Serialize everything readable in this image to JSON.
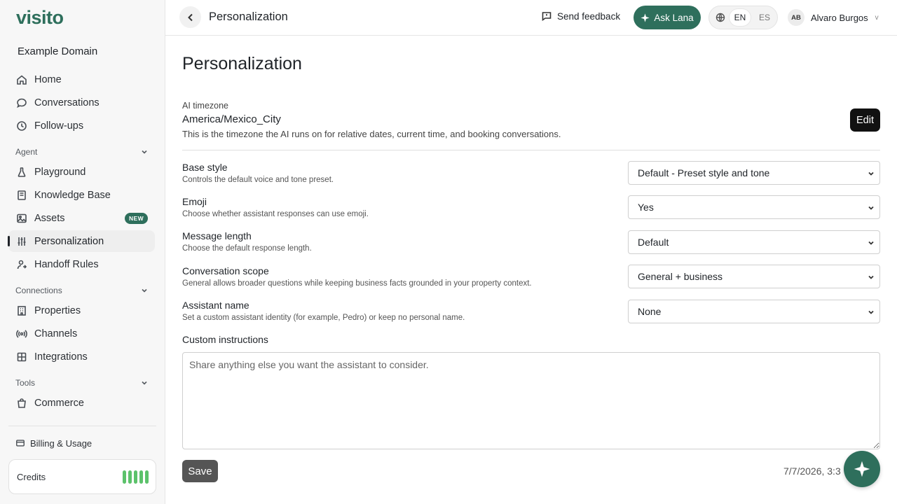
{
  "brand": {
    "logo": "visito",
    "domain": "Example Domain",
    "accent": "#2e6f5c"
  },
  "sidebar": {
    "top_items": [
      {
        "label": "Home",
        "icon": "home-icon"
      },
      {
        "label": "Conversations",
        "icon": "chat-bubble-icon"
      },
      {
        "label": "Follow-ups",
        "icon": "clock-icon"
      }
    ],
    "agent_section": "Agent",
    "agent_items": [
      {
        "label": "Playground",
        "icon": "flask-icon"
      },
      {
        "label": "Knowledge Base",
        "icon": "book-icon"
      },
      {
        "label": "Assets",
        "icon": "image-icon",
        "badge": "NEW"
      },
      {
        "label": "Personalization",
        "icon": "sliders-icon",
        "active": true
      },
      {
        "label": "Handoff Rules",
        "icon": "user-handoff-icon"
      }
    ],
    "connections_section": "Connections",
    "connections_items": [
      {
        "label": "Properties",
        "icon": "building-icon"
      },
      {
        "label": "Channels",
        "icon": "broadcast-icon"
      },
      {
        "label": "Integrations",
        "icon": "puzzle-icon"
      }
    ],
    "tools_section": "Tools",
    "tools_items": [
      {
        "label": "Commerce",
        "icon": "shopping-bag-icon"
      }
    ],
    "billing": "Billing & Usage",
    "credits": "Credits"
  },
  "header": {
    "title": "Personalization",
    "feedback": "Send feedback",
    "ask": "Ask Lana",
    "lang_en": "EN",
    "lang_es": "ES",
    "user_initials": "AB",
    "user_name": "Alvaro Burgos",
    "user_chevron": "v"
  },
  "main": {
    "title": "Personalization",
    "timezone": {
      "label": "AI timezone",
      "value": "America/Mexico_City",
      "desc": "This is the timezone the AI runs on for relative dates, current time, and booking conversations.",
      "edit": "Edit"
    },
    "fields": [
      {
        "label": "Base style",
        "desc": "Controls the default voice and tone preset.",
        "value": "Default - Preset style and tone"
      },
      {
        "label": "Emoji",
        "desc": "Choose whether assistant responses can use emoji.",
        "value": "Yes"
      },
      {
        "label": "Message length",
        "desc": "Choose the default response length.",
        "value": "Default"
      },
      {
        "label": "Conversation scope",
        "desc": "General allows broader questions while keeping business facts grounded in your property context.",
        "value": "General + business"
      },
      {
        "label": "Assistant name",
        "desc": "Set a custom assistant identity (for example, Pedro) or keep no personal name.",
        "value": "None"
      }
    ],
    "custom": {
      "label": "Custom instructions",
      "placeholder": "Share anything else you want the assistant to consider."
    },
    "save": "Save",
    "timestamp": "7/7/2026, 3:3"
  }
}
